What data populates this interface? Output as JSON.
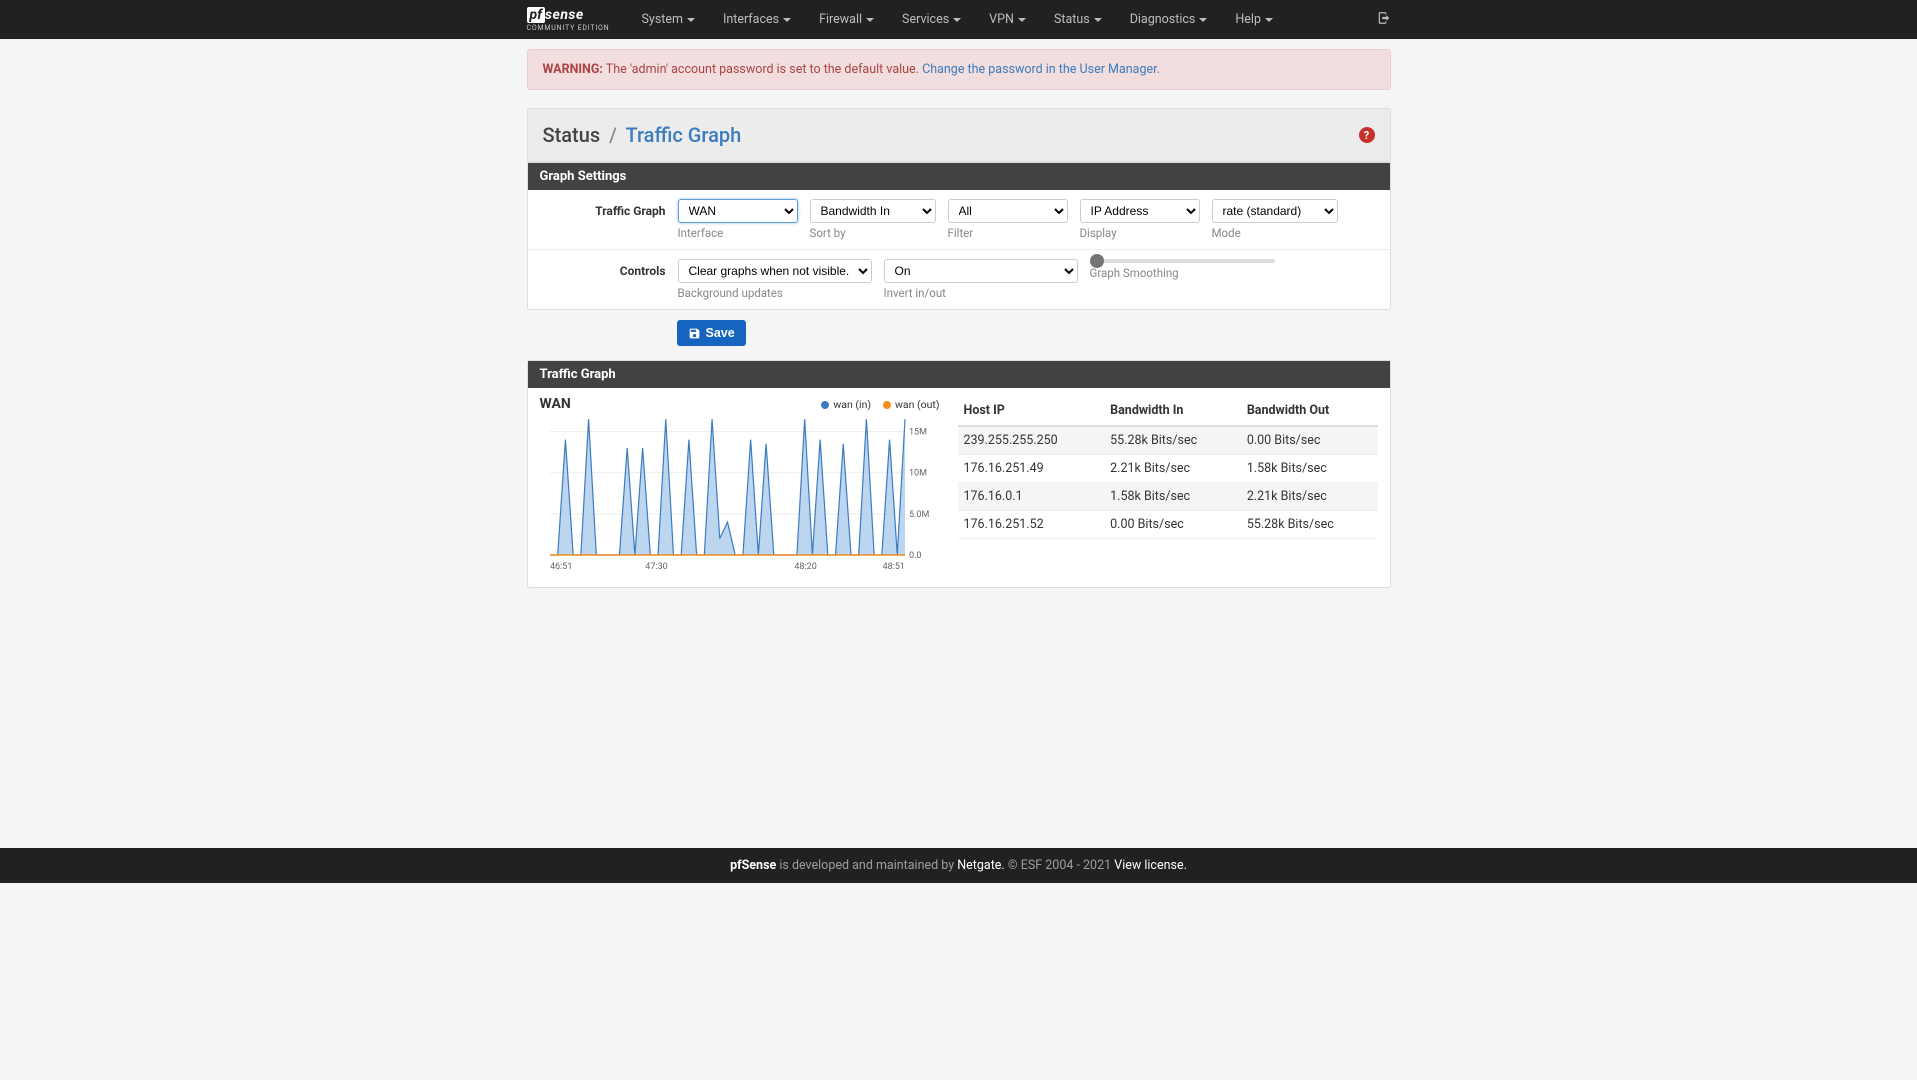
{
  "brand": {
    "pf": "pf",
    "sense": "sense",
    "edition": "COMMUNITY EDITION"
  },
  "nav": [
    "System",
    "Interfaces",
    "Firewall",
    "Services",
    "VPN",
    "Status",
    "Diagnostics",
    "Help"
  ],
  "alert": {
    "prefix": "WARNING:",
    "text": " The 'admin' account password is set to the default value. ",
    "link": "Change the password in the User Manager."
  },
  "breadcrumb": {
    "parent": "Status",
    "sep": "/",
    "current": "Traffic Graph"
  },
  "panel1_title": "Graph Settings",
  "row1_label": "Traffic Graph",
  "row2_label": "Controls",
  "controls": {
    "interface": {
      "value": "WAN",
      "help": "Interface"
    },
    "sortby": {
      "value": "Bandwidth In",
      "help": "Sort by"
    },
    "filter": {
      "value": "All",
      "help": "Filter"
    },
    "display": {
      "value": "IP Address",
      "help": "Display"
    },
    "mode": {
      "value": "rate (standard)",
      "help": "Mode"
    },
    "bg": {
      "value": "Clear graphs when not visible.",
      "help": "Background updates"
    },
    "invert": {
      "value": "On",
      "help": "Invert in/out"
    },
    "smoothing_help": "Graph Smoothing"
  },
  "save_label": "Save",
  "panel2_title": "Traffic Graph",
  "chart_title": "WAN",
  "legend": {
    "in": "wan (in)",
    "out": "wan (out)",
    "in_color": "#3b7bbf",
    "out_color": "#f68c1f"
  },
  "table": {
    "headers": [
      "Host IP",
      "Bandwidth In",
      "Bandwidth Out"
    ],
    "rows": [
      [
        "239.255.255.250",
        "55.28k Bits/sec",
        "0.00 Bits/sec"
      ],
      [
        "176.16.251.49",
        "2.21k Bits/sec",
        "1.58k Bits/sec"
      ],
      [
        "176.16.0.1",
        "1.58k Bits/sec",
        "2.21k Bits/sec"
      ],
      [
        "176.16.251.52",
        "0.00 Bits/sec",
        "55.28k Bits/sec"
      ]
    ]
  },
  "chart_data": {
    "type": "line",
    "title": "WAN",
    "x_ticks": [
      "46:51",
      "47:30",
      "48:20",
      "48:51"
    ],
    "y_ticks": [
      "0.0",
      "5.0M",
      "10M",
      "15M"
    ],
    "ylim": [
      0,
      17000000
    ],
    "series": [
      {
        "name": "wan (in)",
        "color": "#3b7bbf",
        "values": [
          0,
          0,
          14000000,
          0,
          0,
          16500000,
          0,
          0,
          0,
          0,
          13000000,
          0,
          13000000,
          0,
          0,
          16500000,
          0,
          0,
          14000000,
          0,
          0,
          16500000,
          2000000,
          4000000,
          0,
          0,
          14000000,
          0,
          13500000,
          0,
          0,
          0,
          0,
          16500000,
          0,
          14000000,
          0,
          0,
          13500000,
          0,
          0,
          16500000,
          0,
          0,
          14000000,
          0,
          16500000
        ]
      },
      {
        "name": "wan (out)",
        "color": "#f68c1f",
        "values": [
          0,
          0,
          0,
          0,
          0,
          0,
          0,
          0,
          0,
          0,
          0,
          0,
          0,
          0,
          0,
          0,
          0,
          0,
          0,
          0,
          0,
          0,
          0,
          0,
          0,
          0,
          0,
          0,
          0,
          0,
          0,
          0,
          0,
          0,
          0,
          0,
          0,
          0,
          0,
          0,
          0,
          0,
          0,
          0,
          0,
          0,
          0
        ]
      }
    ]
  },
  "footer": {
    "pfsense": "pfSense",
    "maintained": " is developed and maintained by ",
    "netgate": "Netgate.",
    "esf": " © ESF 2004 - 2021 ",
    "license": "View license."
  }
}
